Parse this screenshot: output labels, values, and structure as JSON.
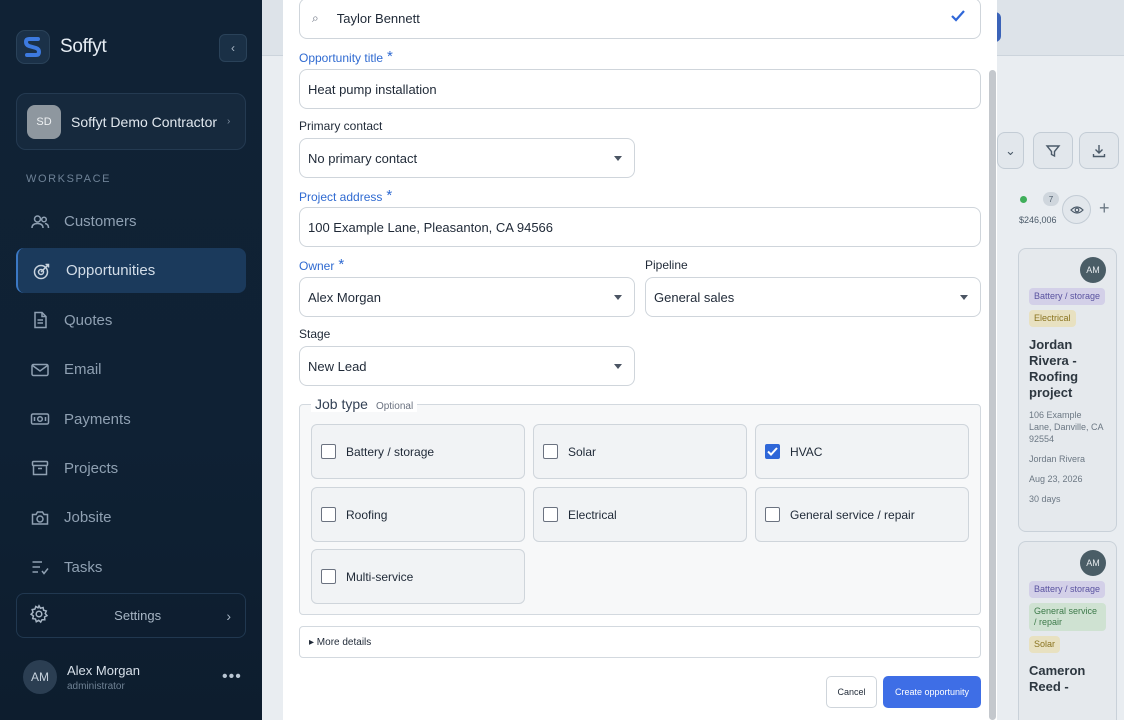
{
  "sidebar": {
    "brand": "Soffyt",
    "org": {
      "initials": "SD",
      "name": "Soffyt Demo Contractor"
    },
    "section_label": "WORKSPACE",
    "items": [
      {
        "label": "Customers",
        "icon": "users-icon"
      },
      {
        "label": "Opportunities",
        "icon": "target-icon",
        "active": true
      },
      {
        "label": "Quotes",
        "icon": "document-icon"
      },
      {
        "label": "Email",
        "icon": "mail-icon"
      },
      {
        "label": "Payments",
        "icon": "money-icon"
      },
      {
        "label": "Projects",
        "icon": "box-icon"
      },
      {
        "label": "Jobsite",
        "icon": "camera-icon"
      },
      {
        "label": "Tasks",
        "icon": "checklist-icon"
      }
    ],
    "settings_label": "Settings",
    "user": {
      "initials": "AM",
      "name": "Alex Morgan",
      "role": "administrator"
    }
  },
  "background": {
    "column": {
      "count": "7",
      "total": "$246,006"
    },
    "cards": [
      {
        "initials": "AM",
        "tags": [
          "Battery / storage",
          "Electrical"
        ],
        "title": "Jordan Rivera - Roofing project",
        "address": "106 Example Lane, Danville, CA 92554",
        "contact": "Jordan Rivera",
        "date": "Aug 23, 2026",
        "age": "30 days"
      },
      {
        "initials": "AM",
        "tags": [
          "Battery / storage",
          "General service / repair",
          "Solar"
        ],
        "title": "Cameron Reed -"
      }
    ]
  },
  "form": {
    "customer_value": "Taylor Bennett",
    "title_label": "Opportunity title",
    "title_value": "Heat pump installation",
    "contact_label": "Primary contact",
    "contact_value": "No primary contact",
    "address_label": "Project address",
    "address_value": "100 Example Lane, Pleasanton, CA 94566",
    "owner_label": "Owner",
    "owner_value": "Alex Morgan",
    "pipeline_label": "Pipeline",
    "pipeline_value": "General sales",
    "stage_label": "Stage",
    "stage_value": "New Lead",
    "job_type_label": "Job type",
    "job_type_optional": "Optional",
    "job_types": [
      {
        "label": "Battery / storage",
        "checked": false
      },
      {
        "label": "Solar",
        "checked": false
      },
      {
        "label": "HVAC",
        "checked": true
      },
      {
        "label": "Roofing",
        "checked": false
      },
      {
        "label": "Electrical",
        "checked": false
      },
      {
        "label": "General service / repair",
        "checked": false
      },
      {
        "label": "Multi-service",
        "checked": false
      }
    ],
    "more_details": "▸ More details",
    "cancel_label": "Cancel",
    "create_label": "Create opportunity"
  },
  "colors": {
    "accent": "#3e6ee6",
    "sidebar_bg": "#102235",
    "active_nav": "#1b3a5c"
  }
}
